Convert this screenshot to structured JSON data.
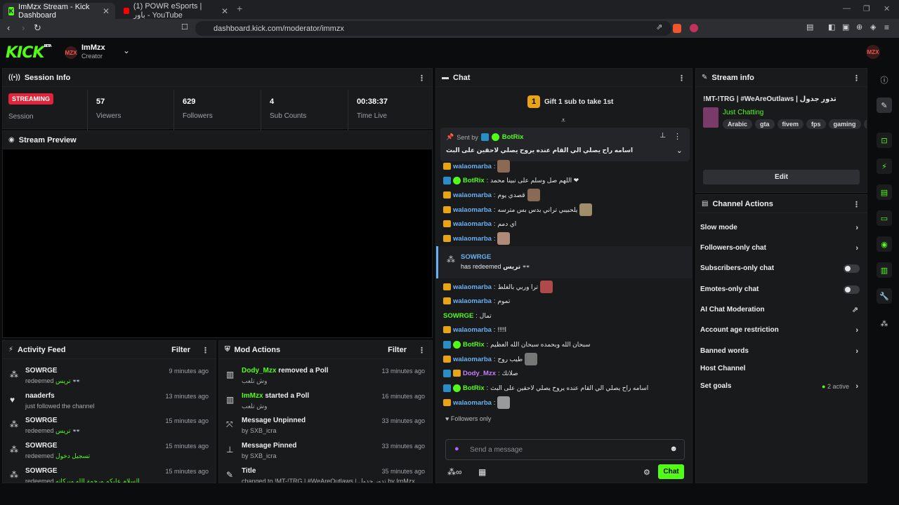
{
  "browser": {
    "tabs": [
      {
        "label": "ImMzx Stream - Kick Dashboard"
      },
      {
        "label": "(1) POWR eSports | باور - YouTube"
      }
    ],
    "url": "dashboard.kick.com/moderator/immzx"
  },
  "header": {
    "logo": "KICK",
    "logo_sup": "BETA",
    "channel_name": "ImMzx",
    "channel_role": "Creator",
    "avatar_text": "MZX"
  },
  "session": {
    "title": "Session Info",
    "status": "STREAMING",
    "status_label": "Session",
    "stats": [
      {
        "value": "57",
        "label": "Viewers"
      },
      {
        "value": "629",
        "label": "Followers"
      },
      {
        "value": "4",
        "label": "Sub Counts"
      },
      {
        "value": "00:38:37",
        "label": "Time Live"
      }
    ]
  },
  "preview": {
    "title": "Stream Preview"
  },
  "activity": {
    "title": "Activity Feed",
    "filter": "Filter",
    "items": [
      {
        "user": "SOWRGE",
        "desc": "redeemed",
        "extra": "تريس 👓",
        "time": "9 minutes ago"
      },
      {
        "user": "naaderfs",
        "desc": "just followed the channel",
        "extra": "",
        "time": "13 minutes ago"
      },
      {
        "user": "SOWRGE",
        "desc": "redeemed",
        "extra": "تريس 👓",
        "time": "15 minutes ago"
      },
      {
        "user": "SOWRGE",
        "desc": "redeemed",
        "extra": "تسجيل دخول",
        "time": "15 minutes ago"
      },
      {
        "user": "SOWRGE",
        "desc": "redeemed",
        "extra": "السلام عليكم ورحمة الله وبركاته",
        "time": "15 minutes ago"
      }
    ]
  },
  "mod_actions": {
    "title": "Mod Actions",
    "filter": "Filter",
    "items": [
      {
        "actor": "Dody_Mzx",
        "action": "removed a Poll",
        "sub": "وش تلعب",
        "time": "13 minutes ago"
      },
      {
        "actor": "ImMzx",
        "action": "started a Poll",
        "sub": "وش تلعب",
        "time": "16 minutes ago"
      },
      {
        "actor": "",
        "action": "Message Unpinned",
        "sub": "by SXB_icra",
        "time": "33 minutes ago"
      },
      {
        "actor": "",
        "action": "Message Pinned",
        "sub": "by SXB_icra",
        "time": "33 minutes ago"
      },
      {
        "actor": "",
        "action": "Title",
        "sub": "changed to !MT-!TRG | #WeAreOutlaws | تدور جدول by ImMzx",
        "time": "35 minutes ago"
      }
    ]
  },
  "chat": {
    "title": "Chat",
    "gift_num": "1",
    "gift_text": "Gift 1 sub to take 1st",
    "pinned_sent_by": "Sent by",
    "pinned_user": "BotRix",
    "pinned_text": "اسامه راح يصلي الي القام عنده يروح يصلي لاحقين على البث",
    "followers_only": "Followers only",
    "placeholder": "Send a message",
    "send": "Chat",
    "messages": [
      {
        "user": "walaomarba",
        "text": ""
      },
      {
        "user": "BotRix",
        "text": "اللهم صل وسلم على نبينا محمد ❤"
      },
      {
        "user": "walaomarba",
        "text": "قصدي يوم"
      },
      {
        "user": "walaomarba",
        "text": "يلحبيبي تراني بدس بس مترسه"
      },
      {
        "user": "walaomarba",
        "text": "اي دمم"
      },
      {
        "user": "walaomarba",
        "text": ""
      },
      {
        "user": "walaomarba",
        "text": "ترا وربي بالغلط"
      },
      {
        "user": "walaomarba",
        "text": "تموم"
      },
      {
        "user": "SOWRGE",
        "text": "تمال"
      },
      {
        "user": "walaomarba",
        "text": "!!!!ا"
      },
      {
        "user": "BotRix",
        "text": "سبحان الله وبحمده سبحان الله العظيم"
      },
      {
        "user": "walaomarba",
        "text": "طيب روح"
      },
      {
        "user": "Dody_Mzx",
        "text": "صلاتك"
      },
      {
        "user": "BotRix",
        "text": "اسامه راح يصلي الي القام عنده يروح يصلي لاحقين على البث"
      },
      {
        "user": "walaomarba",
        "text": ""
      }
    ],
    "redeem_user": "SOWRGE",
    "redeem_text": "has redeemed",
    "redeem_item": "تريس 👓"
  },
  "stream_info": {
    "title": "Stream info",
    "stream_title": "!MT-!TRG | #WeAreOutlaws | تدور جدول",
    "category": "Just Chatting",
    "tags": [
      "Arabic",
      "gta",
      "fivem",
      "fps",
      "gaming",
      "mt"
    ],
    "edit": "Edit"
  },
  "channel_actions": {
    "title": "Channel Actions",
    "rows": [
      {
        "label": "Slow mode"
      },
      {
        "label": "Followers-only chat"
      },
      {
        "label": "Subscribers-only chat"
      },
      {
        "label": "Emotes-only chat"
      },
      {
        "label": "AI Chat Moderation"
      },
      {
        "label": "Account age restriction"
      },
      {
        "label": "Banned words"
      },
      {
        "label": "Host Channel"
      },
      {
        "label": "Set goals"
      }
    ],
    "goals_active": "2 active"
  },
  "colors": {
    "accent": "#53fc18",
    "streaming": "#e0243b",
    "username": "#6ab0f3"
  }
}
